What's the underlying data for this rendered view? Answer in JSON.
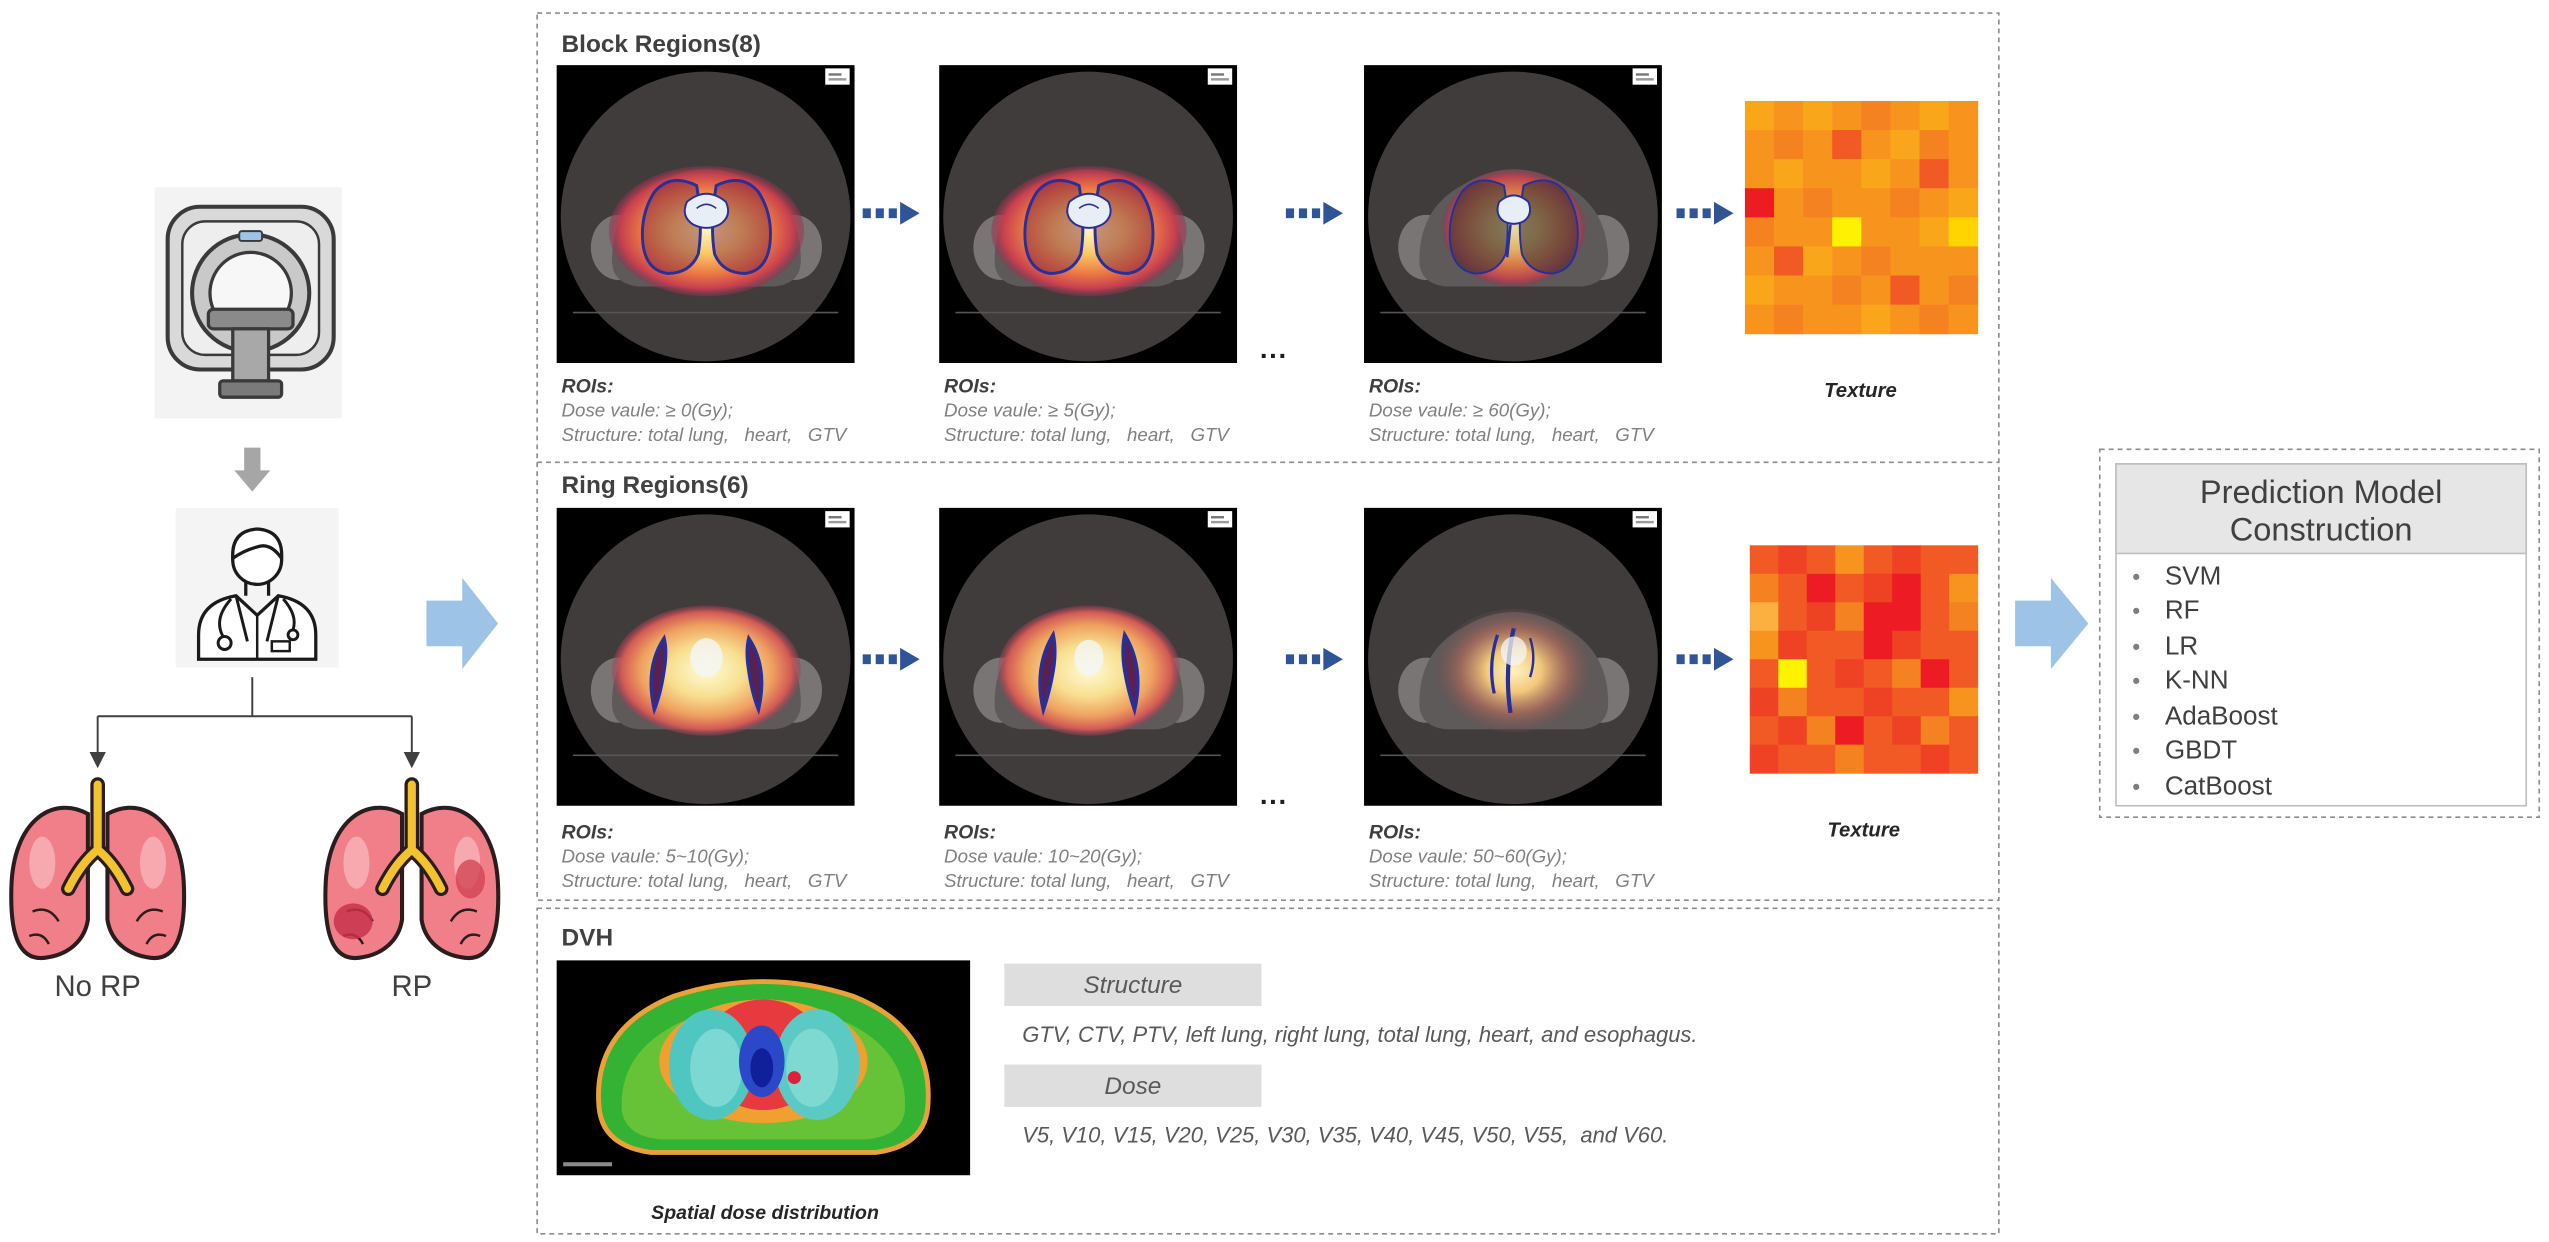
{
  "left_panel": {
    "scanner_icon": "ct-scanner-icon",
    "clinician_icon": "doctor-icon",
    "outcomes": [
      {
        "label": "No RP",
        "icon": "healthy-lungs-icon"
      },
      {
        "label": "RP",
        "icon": "injured-lungs-icon"
      }
    ]
  },
  "block_regions": {
    "title": "Block Regions(8)",
    "panels": [
      {
        "roi_label": "ROIs:",
        "dose": "Dose vaule: ≥ 0(Gy);",
        "structure": "Structure: total lung,   heart,   GTV"
      },
      {
        "roi_label": "ROIs:",
        "dose": "Dose vaule: ≥ 5(Gy);",
        "structure": "Structure: total lung,   heart,   GTV"
      },
      {
        "roi_label": "ROIs:",
        "dose": "Dose vaule: ≥ 60(Gy);",
        "structure": "Structure: total lung,   heart,   GTV"
      }
    ],
    "ellipsis": "...",
    "texture_label": "Texture"
  },
  "ring_regions": {
    "title": "Ring Regions(6)",
    "panels": [
      {
        "roi_label": "ROIs:",
        "dose": "Dose vaule: 5~10(Gy);",
        "structure": "Structure: total lung,   heart,   GTV"
      },
      {
        "roi_label": "ROIs:",
        "dose": "Dose vaule: 10~20(Gy);",
        "structure": "Structure: total lung,   heart,   GTV"
      },
      {
        "roi_label": "ROIs:",
        "dose": "Dose vaule: 50~60(Gy);",
        "structure": "Structure: total lung,   heart,   GTV"
      }
    ],
    "ellipsis": "...",
    "texture_label": "Texture"
  },
  "dvh": {
    "title": "DVH",
    "image_caption": "Spatial dose distribution",
    "structure_header": "Structure",
    "structure_text": "GTV, CTV, PTV, left lung, right lung, total lung, heart, and esophagus.",
    "dose_header": "Dose",
    "dose_text": "V5, V10, V15, V20, V25, V30, V35, V40, V45, V50, V55,  and V60."
  },
  "prediction": {
    "title_line1": "Prediction Model",
    "title_line2": "Construction",
    "models": [
      "SVM",
      "RF",
      "LR",
      "K-NN",
      "AdaBoost",
      "GBDT",
      "CatBoost"
    ]
  },
  "colors": {
    "flow_arrow": "#9dc3e6",
    "step_arrow": "#2f5597",
    "down_arrow": "#a6a6a6",
    "box_border": "#8c8c8c",
    "header_fill": "#e7e6e6",
    "tag_fill": "#dedede"
  }
}
